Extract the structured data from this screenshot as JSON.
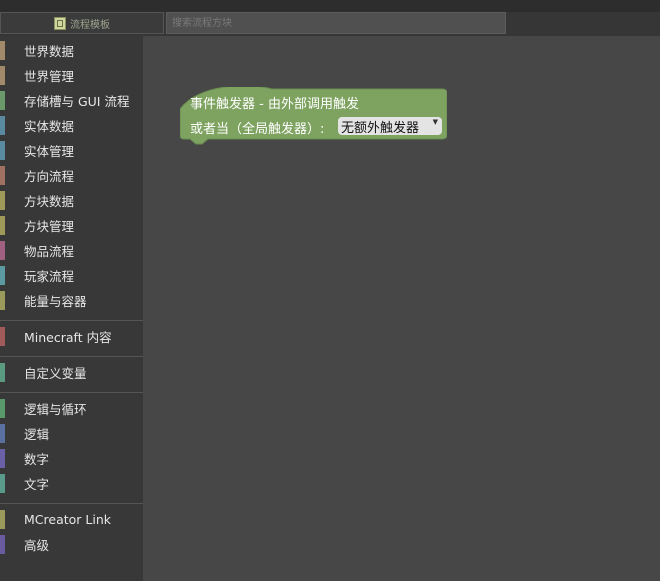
{
  "tabs": {
    "templates_label": "流程模板",
    "search_placeholder": "搜索流程方块"
  },
  "sidebar": {
    "categories": [
      {
        "label": "世界数据",
        "color": "#a08a6a"
      },
      {
        "label": "世界管理",
        "color": "#a08a6a"
      },
      {
        "label": "存储槽与 GUI 流程",
        "color": "#6a9a6a"
      },
      {
        "label": "实体数据",
        "color": "#5a8aa0"
      },
      {
        "label": "实体管理",
        "color": "#5a8aa0"
      },
      {
        "label": "方向流程",
        "color": "#a07060"
      },
      {
        "label": "方块数据",
        "color": "#a09a5a"
      },
      {
        "label": "方块管理",
        "color": "#a09a5a"
      },
      {
        "label": "物品流程",
        "color": "#a06080"
      },
      {
        "label": "玩家流程",
        "color": "#5a9aa0"
      },
      {
        "label": "能量与容器",
        "color": "#9a9a5a"
      },
      {
        "label": "Minecraft 内容",
        "color": "#a05a5a"
      },
      {
        "label": "自定义变量",
        "color": "#5a9a80"
      },
      {
        "label": "逻辑与循环",
        "color": "#5a9a6a"
      },
      {
        "label": "逻辑",
        "color": "#5a70a0"
      },
      {
        "label": "数字",
        "color": "#6a60a8"
      },
      {
        "label": "文字",
        "color": "#5a9a8a"
      },
      {
        "label": "MCreator Link",
        "color": "#9a9a5a"
      },
      {
        "label": "高级",
        "color": "#6a5aa0"
      }
    ]
  },
  "block": {
    "title": "事件触发器 - 由外部调用触发",
    "line2": "或者当（全局触发器）:",
    "dropdown_value": "无额外触发器",
    "color": "#7ea360"
  }
}
